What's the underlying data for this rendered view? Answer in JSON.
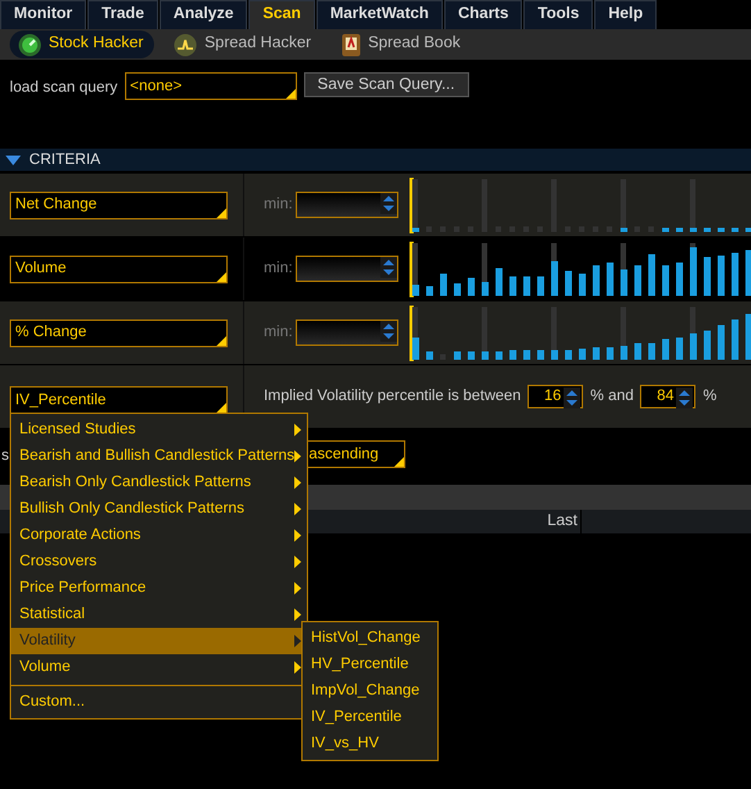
{
  "tabs": [
    {
      "label": "Monitor",
      "selected": false
    },
    {
      "label": "Trade",
      "selected": false
    },
    {
      "label": "Analyze",
      "selected": false
    },
    {
      "label": "Scan",
      "selected": true
    },
    {
      "label": "MarketWatch",
      "selected": false
    },
    {
      "label": "Charts",
      "selected": false
    },
    {
      "label": "Tools",
      "selected": false
    },
    {
      "label": "Help",
      "selected": false
    }
  ],
  "subtabs": [
    {
      "label": "Stock Hacker",
      "selected": true
    },
    {
      "label": "Spread Hacker",
      "selected": false
    },
    {
      "label": "Spread Book",
      "selected": false
    }
  ],
  "load_query": {
    "label": "load scan query",
    "value": "<none>",
    "button": "Save Scan Query..."
  },
  "criteria": {
    "title": "CRITERIA",
    "expanded": true,
    "rows": [
      {
        "kind": "range",
        "field": "Net Change",
        "min_label": "min:"
      },
      {
        "kind": "range",
        "field": "Volume",
        "min_label": "min:"
      },
      {
        "kind": "range",
        "field": "% Change",
        "min_label": "min:"
      },
      {
        "kind": "percentile",
        "field": "IV_Percentile",
        "text": "Implied Volatility percentile is between",
        "low": "16",
        "between": "% and",
        "high": "84",
        "unit": "%"
      }
    ]
  },
  "sort": {
    "label": "s",
    "order": "ascending"
  },
  "results": {
    "columns": [
      "Last"
    ]
  },
  "menu": {
    "items": [
      {
        "label": "Licensed Studies",
        "submenu": true,
        "selected": false,
        "separator_before": false
      },
      {
        "label": "Bearish and Bullish Candlestick Patterns",
        "submenu": true,
        "selected": false,
        "separator_before": false
      },
      {
        "label": "Bearish Only Candlestick Patterns",
        "submenu": true,
        "selected": false,
        "separator_before": false
      },
      {
        "label": "Bullish Only Candlestick Patterns",
        "submenu": true,
        "selected": false,
        "separator_before": false
      },
      {
        "label": "Corporate Actions",
        "submenu": true,
        "selected": false,
        "separator_before": false
      },
      {
        "label": "Crossovers",
        "submenu": true,
        "selected": false,
        "separator_before": false
      },
      {
        "label": "Price Performance",
        "submenu": true,
        "selected": false,
        "separator_before": false
      },
      {
        "label": "Statistical",
        "submenu": true,
        "selected": false,
        "separator_before": false
      },
      {
        "label": "Volatility",
        "submenu": true,
        "selected": true,
        "separator_before": false
      },
      {
        "label": "Volume",
        "submenu": true,
        "selected": false,
        "separator_before": false
      },
      {
        "label": "Custom...",
        "submenu": false,
        "selected": false,
        "separator_before": true
      }
    ],
    "submenu": [
      "HistVol_Change",
      "HV_Percentile",
      "ImpVol_Change",
      "IV_Percentile",
      "IV_vs_HV"
    ]
  }
}
